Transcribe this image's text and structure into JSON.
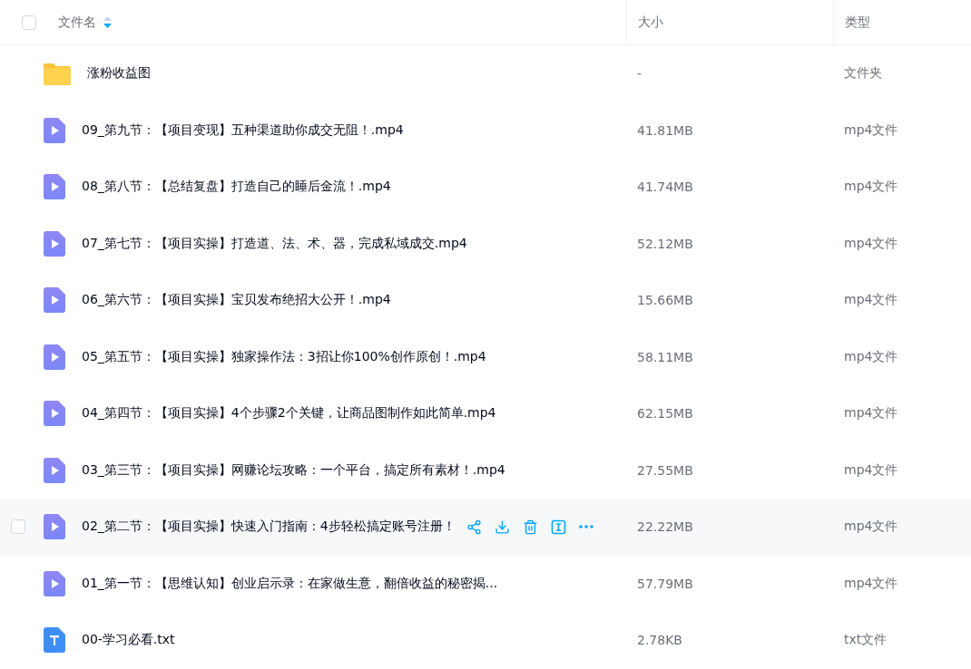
{
  "header": {
    "columns": [
      "文件名",
      "大小",
      "类型"
    ],
    "select_all_checked": false
  },
  "rows": [
    {
      "kind": "folder",
      "name": "涨粉收益图",
      "size": "-",
      "type": "文件夹",
      "hovered": false
    },
    {
      "kind": "video",
      "name": "09_第九节：【项目变现】五种渠道助你成交无阻！.mp4",
      "size": "41.81MB",
      "type": "mp4文件",
      "hovered": false
    },
    {
      "kind": "video",
      "name": "08_第八节：【总结复盘】打造自己的睡后金流！.mp4",
      "size": "41.74MB",
      "type": "mp4文件",
      "hovered": false
    },
    {
      "kind": "video",
      "name": "07_第七节：【项目实操】打造道、法、术、器，完成私域成交.mp4",
      "size": "52.12MB",
      "type": "mp4文件",
      "hovered": false
    },
    {
      "kind": "video",
      "name": "06_第六节：【项目实操】宝贝发布绝招大公开！.mp4",
      "size": "15.66MB",
      "type": "mp4文件",
      "hovered": false
    },
    {
      "kind": "video",
      "name": "05_第五节：【项目实操】独家操作法：3招让你100%创作原创！.mp4",
      "size": "58.11MB",
      "type": "mp4文件",
      "hovered": false
    },
    {
      "kind": "video",
      "name": "04_第四节：【项目实操】4个步骤2个关键，让商品图制作如此简单.mp4",
      "size": "62.15MB",
      "type": "mp4文件",
      "hovered": false
    },
    {
      "kind": "video",
      "name": "03_第三节：【项目实操】网赚论坛攻略：一个平台，搞定所有素材！.mp4",
      "size": "27.55MB",
      "type": "mp4文件",
      "hovered": false
    },
    {
      "kind": "video",
      "name": "02_第二节：【项目实操】快速入门指南：4步轻松搞定账号注册！",
      "size": "22.22MB",
      "type": "mp4文件",
      "hovered": true
    },
    {
      "kind": "video",
      "name": "01_第一节：【思维认知】创业启示录：在家做生意，翻倍收益的秘密揭...",
      "size": "57.79MB",
      "type": "mp4文件",
      "hovered": false
    },
    {
      "kind": "text",
      "name": "00-学习必看.txt",
      "size": "2.78KB",
      "type": "txt文件",
      "hovered": false
    }
  ]
}
